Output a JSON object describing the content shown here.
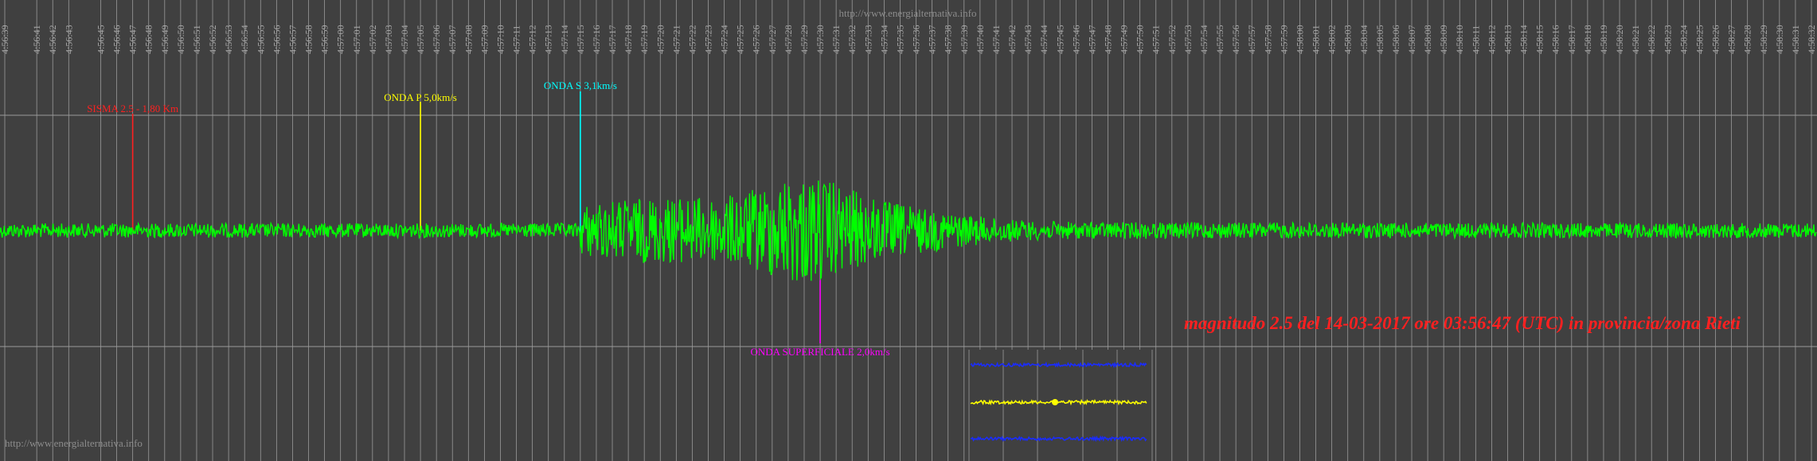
{
  "watermark_top": "http://www.energialternativa.info",
  "watermark_bottom": "http://www.energialternativa.info",
  "headline": "magnitudo 2.5 del 14-03-2017 ore 03:56:47 (UTC) in provincia/zona Rieti",
  "colors": {
    "background": "#404040",
    "grid": "#9a9a9a",
    "trace": "#00ff00",
    "headline": "#ff2020",
    "event": "#ff2020",
    "p_wave": "#ffff00",
    "s_wave": "#00ffff",
    "surface_wave": "#ff00ff",
    "inset_blue": "#1a2cff",
    "inset_yellow": "#ffff00"
  },
  "chart_data": {
    "type": "line",
    "title": "",
    "xlabel": "",
    "ylabel": "",
    "grid": true,
    "x_ticks": [
      "4:56:39",
      "4:56:41",
      "4:56:42",
      "4:56:43",
      "4:56:45",
      "4:56:46",
      "4:56:47",
      "4:56:48",
      "4:56:49",
      "4:56:50",
      "4:56:51",
      "4:56:52",
      "4:56:53",
      "4:56:54",
      "4:56:55",
      "4:56:56",
      "4:56:57",
      "4:56:58",
      "4:56:59",
      "4:57:00",
      "4:57:01",
      "4:57:02",
      "4:57:03",
      "4:57:04",
      "4:57:05",
      "4:57:06",
      "4:57:07",
      "4:57:08",
      "4:57:09",
      "4:57:10",
      "4:57:11",
      "4:57:12",
      "4:57:13",
      "4:57:14",
      "4:57:15",
      "4:57:16",
      "4:57:17",
      "4:57:18",
      "4:57:19",
      "4:57:20",
      "4:57:21",
      "4:57:22",
      "4:57:23",
      "4:57:24",
      "4:57:25",
      "4:57:26",
      "4:57:27",
      "4:57:28",
      "4:57:29",
      "4:57:30",
      "4:57:31",
      "4:57:32",
      "4:57:33",
      "4:57:34",
      "4:57:35",
      "4:57:36",
      "4:57:37",
      "4:57:38",
      "4:57:39",
      "4:57:40",
      "4:57:41",
      "4:57:42",
      "4:57:43",
      "4:57:44",
      "4:57:45",
      "4:57:46",
      "4:57:47",
      "4:57:48",
      "4:57:49",
      "4:57:50",
      "4:57:51",
      "4:57:52",
      "4:57:53",
      "4:57:54",
      "4:57:55",
      "4:57:56",
      "4:57:57",
      "4:57:58",
      "4:57:59",
      "4:58:00",
      "4:58:01",
      "4:58:02",
      "4:58:03",
      "4:58:04",
      "4:58:05",
      "4:58:06",
      "4:58:07",
      "4:58:08",
      "4:58:09",
      "4:58:10",
      "4:58:11",
      "4:58:12",
      "4:58:13",
      "4:58:14",
      "4:58:15",
      "4:58:16",
      "4:58:17",
      "4:58:18",
      "4:58:19",
      "4:58:20",
      "4:58:21",
      "4:58:22",
      "4:58:23",
      "4:58:24",
      "4:58:25",
      "4:58:26",
      "4:58:27",
      "4:58:28",
      "4:58:29",
      "4:58:30",
      "4:58:31",
      "4:58:32"
    ],
    "markers": [
      {
        "label": "SISMA 2.5 - 1,80 Km",
        "time": "4:56:47",
        "color": "#ff2020"
      },
      {
        "label": "ONDA P 5,0km/s",
        "time": "4:57:05",
        "color": "#ffff00"
      },
      {
        "label": "ONDA S 3,1km/s",
        "time": "4:57:15",
        "color": "#00ffff"
      },
      {
        "label": "ONDA SUPERFICIALE 2,0km/s",
        "time": "4:57:30",
        "color": "#ff00ff"
      }
    ],
    "series": [
      {
        "color": "#00ff00"
      }
    ]
  }
}
